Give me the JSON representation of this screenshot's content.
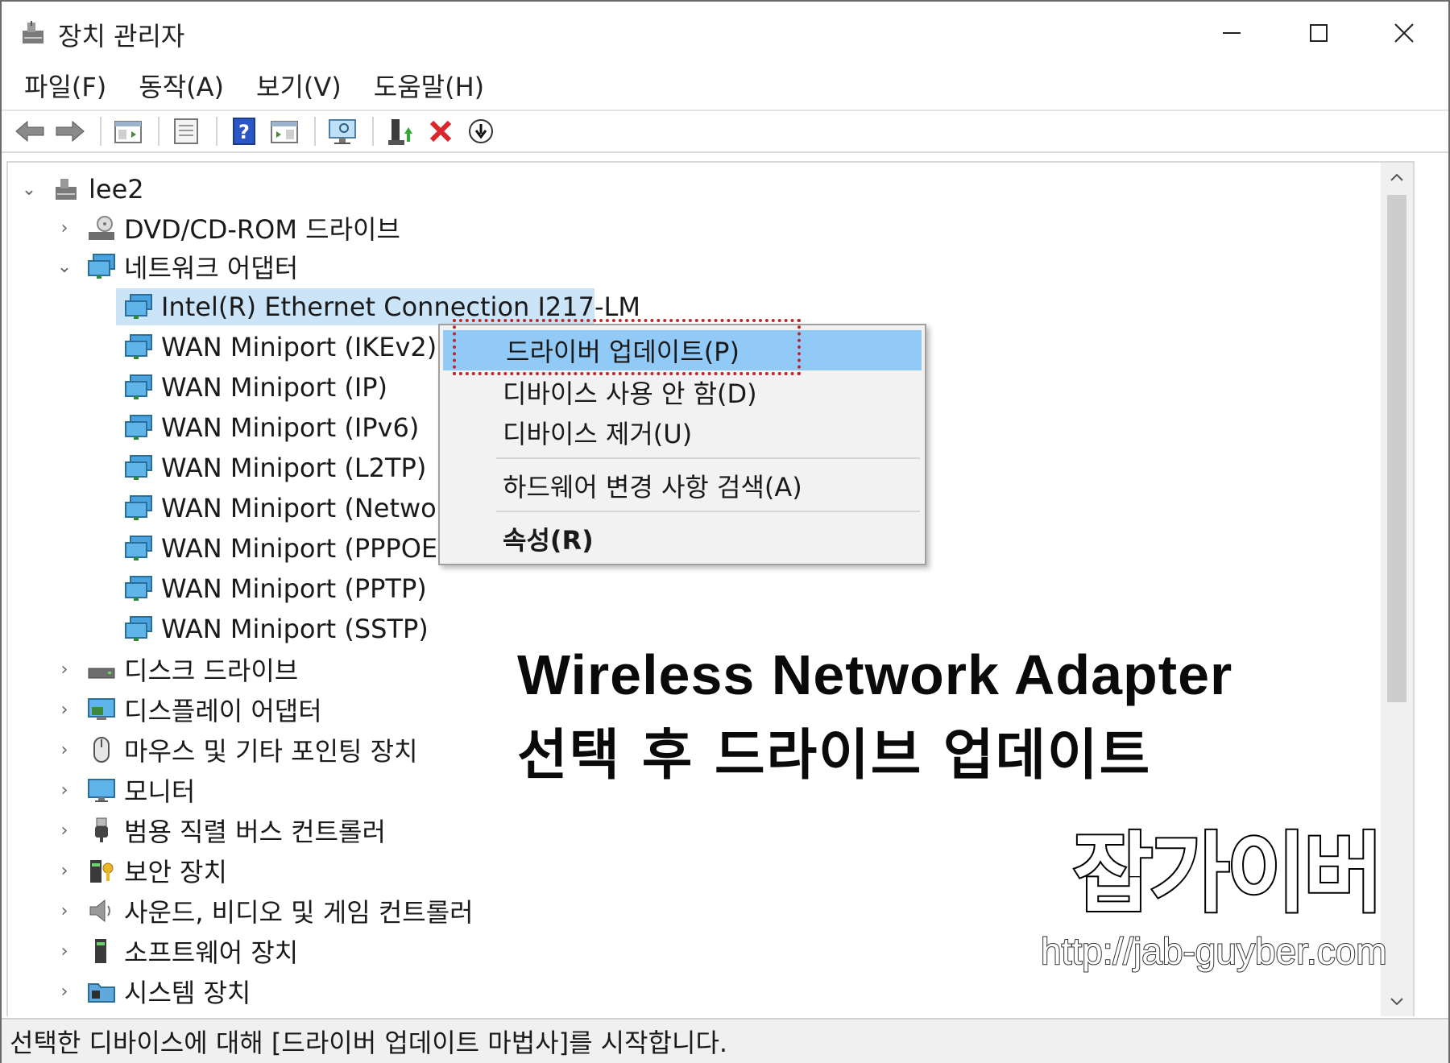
{
  "window": {
    "title": "장치 관리자",
    "icon": "device-manager-icon"
  },
  "menu": [
    "파일(F)",
    "동작(A)",
    "보기(V)",
    "도움말(H)"
  ],
  "toolbar": {
    "buttons": [
      "back-arrow-icon",
      "forward-arrow-icon",
      "show-hide-console-tree-icon",
      "properties-icon",
      "help-icon",
      "action-pane-icon",
      "scan-hardware-icon",
      "update-driver-icon",
      "uninstall-icon",
      "disable-icon"
    ]
  },
  "tree": {
    "root": "lee2",
    "categories": {
      "dvd": "DVD/CD-ROM 드라이브",
      "network": "네트워크 어댑터",
      "disk": "디스크 드라이브",
      "display": "디스플레이 어댑터",
      "mouse": "마우스 및 기타 포인팅 장치",
      "monitor": "모니터",
      "usb": "범용 직렬 버스 컨트롤러",
      "security": "보안 장치",
      "sound": "사운드, 비디오 및 게임 컨트롤러",
      "software": "소프트웨어 장치",
      "system": "시스템 장치"
    },
    "network_adapters": [
      "Intel(R) Ethernet Connection I217-LM",
      "WAN Miniport (IKEv2)",
      "WAN Miniport (IP)",
      "WAN Miniport (IPv6)",
      "WAN Miniport (L2TP)",
      "WAN Miniport (Network",
      "WAN Miniport (PPPOE)",
      "WAN Miniport (PPTP)",
      "WAN Miniport (SSTP)"
    ]
  },
  "context_menu": {
    "update_driver": "드라이버 업데이트(P)",
    "disable_device": "디바이스 사용 안 함(D)",
    "uninstall_device": "디바이스 제거(U)",
    "scan_hardware": "하드웨어 변경 사항 검색(A)",
    "properties": "속성(R)"
  },
  "overlay": {
    "line1": "Wireless Network Adapter",
    "line2": "선택 후 드라이브 업데이트",
    "brand": "잡가이버",
    "url": "http://jab-guyber.com"
  },
  "status": "선택한 디바이스에 대해 [드라이버 업데이트 마법사]를 시작합니다.",
  "colors": {
    "selection": "#cce4f7",
    "menu_hover": "#91c9f7",
    "highlight_box": "#c0282d",
    "delete_red": "#d8262c",
    "help_blue": "#2a56c6"
  }
}
